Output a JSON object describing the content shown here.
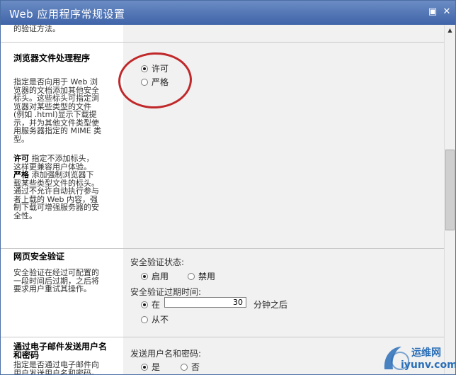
{
  "window": {
    "title": "Web 应用程序常规设置",
    "restore_glyph": "▣",
    "close_glyph": "✕"
  },
  "top_fragment": "的验证方法。",
  "browser_handling": {
    "heading": "浏览器文件处理程序",
    "desc_lines": [
      "指定是否向用于 Web 浏",
      "览器的文档添加其他安全",
      "标头。这些标头可指定浏",
      "览器对某些类型的文件",
      "(例如 .html)显示下载提",
      "示，并为其他文件类型使",
      "用服务器指定的 MIME 类",
      "型。"
    ],
    "permissive_term": "许可",
    "permissive_lines": [
      "指定不添加标头，",
      "这样更兼容用户体验。"
    ],
    "strict_term": "严格",
    "strict_lines": [
      "添加强制浏览器下",
      "载某些类型文件的标头。",
      "通过不允许自动执行参与",
      "者上载的 Web 内容，强",
      "制下载可增强服务器的安",
      "全性。"
    ],
    "options": [
      {
        "label": "许可",
        "selected": true
      },
      {
        "label": "严格",
        "selected": false
      }
    ]
  },
  "page_security": {
    "heading": "网页安全验证",
    "desc_lines": [
      "安全验证在经过可配置的",
      "一段时间后过期，之后将",
      "要求用户重试其操作。"
    ],
    "status_label": "安全验证状态:",
    "status_options": [
      {
        "label": "启用",
        "selected": true
      },
      {
        "label": "禁用",
        "selected": false
      }
    ],
    "expire_label": "安全验证过期时间:",
    "after_label": "在",
    "minutes_value": "30",
    "minutes_suffix": "分钟之后",
    "never_label": "从不"
  },
  "email_credentials": {
    "heading_lines": [
      "通过电子邮件发送用户名",
      "和密码"
    ],
    "desc_lines": [
      "指定是否通过电子邮件向",
      "用户发送用户名和密码。"
    ],
    "send_label": "发送用户名和密码:",
    "options": [
      {
        "label": "是",
        "selected": true
      },
      {
        "label": "否",
        "selected": false
      }
    ]
  },
  "watermark": {
    "name": "运维网",
    "url": "iyunv.com"
  },
  "colors": {
    "titlebar": "#3f64a8",
    "annotation": "#c0282a"
  }
}
